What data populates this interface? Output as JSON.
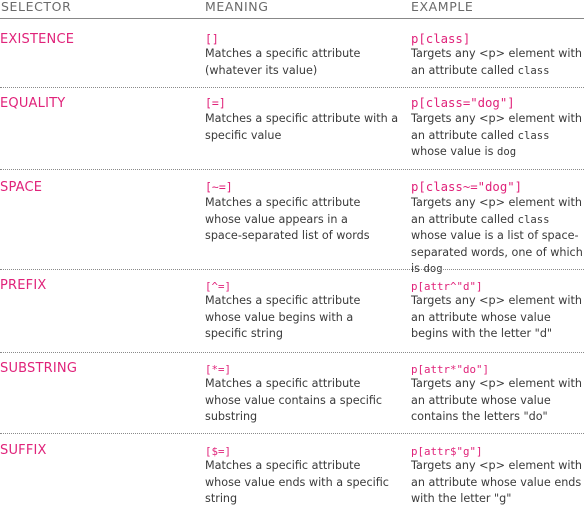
{
  "headers": {
    "selector": "SELECTOR",
    "meaning": "MEANING",
    "example": "EXAMPLE"
  },
  "rows": [
    {
      "selector": "EXISTENCE",
      "operator": "[]",
      "meaning": "Matches a specific attribute (whatever its value)",
      "example_code": "p[class]",
      "example_pre": "Targets any <p> element with an attribute called ",
      "example_mono": "class",
      "example_post": ""
    },
    {
      "selector": "EQUALITY",
      "operator": "[=]",
      "meaning": "Matches a specific attribute with a specific value",
      "example_code": "p[class=\"dog\"]",
      "example_pre": "Targets any <p> element with an attribute called ",
      "example_mono": "class",
      "example_post": " whose value is ",
      "example_mono2": "dog"
    },
    {
      "selector": "SPACE",
      "operator": "[~=]",
      "meaning": "Matches a specific attribute whose value appears in a space-separated list of words",
      "example_code": "p[class~=\"dog\"]",
      "example_pre": "Targets any <p> element with an attribute called ",
      "example_mono": "class",
      "example_post": " whose value is a list of space-separated words, one of which is ",
      "example_mono2": "dog"
    },
    {
      "selector": "PREFIX",
      "operator": "[^=]",
      "meaning": "Matches a specific attribute whose value begins with a specific string",
      "example_code": "p[attr^\"d\"]",
      "example_pre": "Targets any <p> element with an attribute whose value begins with the letter \"d\""
    },
    {
      "selector": "SUBSTRING",
      "operator": "[*=]",
      "meaning": "Matches a specific attribute whose value contains a specific substring",
      "example_code": "p[attr*\"do\"]",
      "example_pre": "Targets any <p> element with an attribute whose value contains the letters \"do\""
    },
    {
      "selector": "SUFFIX",
      "operator": "[$=]",
      "meaning": "Matches a specific attribute whose value ends with a specific string",
      "example_code": "p[attr$\"g\"]",
      "example_pre": "Targets any <p> element with an attribute whose value ends with the letter \"g\""
    }
  ],
  "colors": {
    "accent": "#e0237a",
    "text": "#3a3a3a",
    "header": "#6a6a6a"
  }
}
